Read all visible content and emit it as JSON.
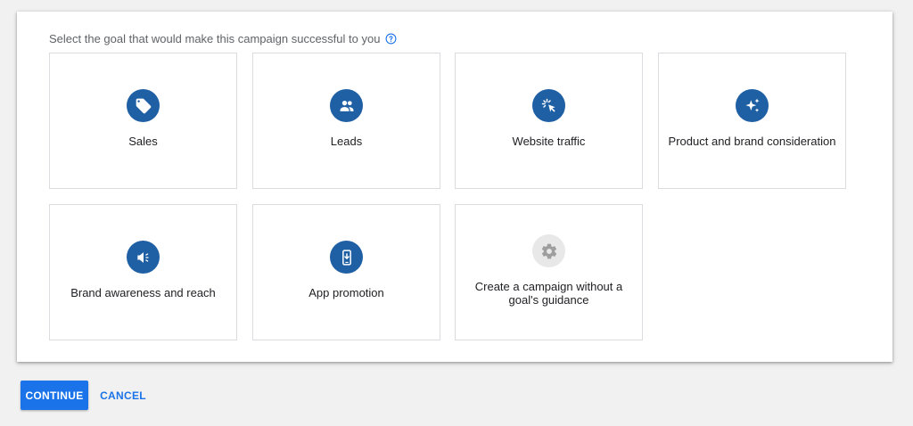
{
  "prompt": {
    "text": "Select the goal that would make this campaign successful to you",
    "help_icon": "question-circle-icon"
  },
  "goals": [
    {
      "label": "Sales",
      "icon": "tag-icon"
    },
    {
      "label": "Leads",
      "icon": "people-icon"
    },
    {
      "label": "Website traffic",
      "icon": "cursor-click-icon"
    },
    {
      "label": "Product and brand consideration",
      "icon": "sparkle-icon"
    },
    {
      "label": "Brand awareness and reach",
      "icon": "megaphone-icon"
    },
    {
      "label": "App promotion",
      "icon": "phone-download-icon"
    },
    {
      "label": "Create a campaign without a goal's guidance",
      "icon": "gear-icon"
    }
  ],
  "actions": {
    "continue_label": "CONTINUE",
    "cancel_label": "CANCEL"
  },
  "colors": {
    "accent": "#1a73e8",
    "icon_background": "#1f5fa3",
    "tile_border": "#dadce0",
    "page_background": "#f1f1f1"
  }
}
